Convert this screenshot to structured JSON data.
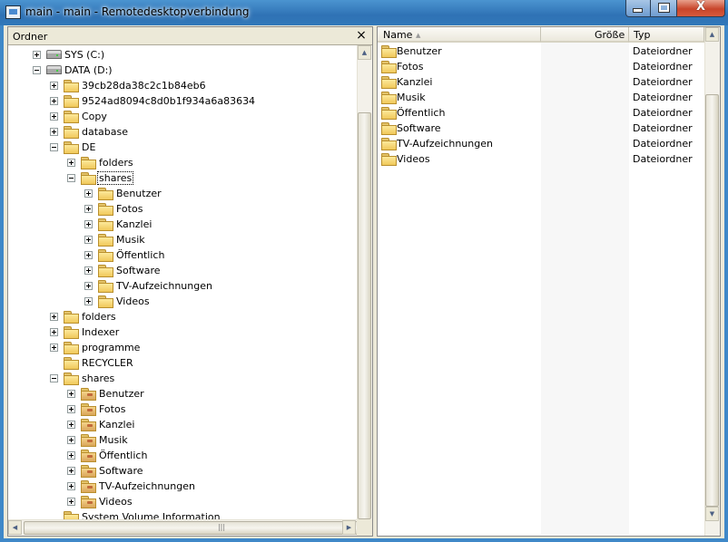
{
  "window": {
    "title": "main - main - Remotedesktopverbindung",
    "minimize_glyph": "",
    "maximize_glyph": "",
    "close_glyph": "X"
  },
  "folder_pane": {
    "title": "Ordner",
    "close_glyph": "×",
    "tree": [
      {
        "label": "SYS (C:)",
        "icon": "drive-icon",
        "expander": "plus",
        "depth": 0
      },
      {
        "label": "DATA (D:)",
        "icon": "drive-icon",
        "expander": "minus",
        "depth": 0
      },
      {
        "label": "39cb28da38c2c1b84eb6",
        "icon": "folder-icon",
        "expander": "plus",
        "depth": 1
      },
      {
        "label": "9524ad8094c8d0b1f934a6a83634",
        "icon": "folder-icon",
        "expander": "plus",
        "depth": 1
      },
      {
        "label": "Copy",
        "icon": "folder-icon",
        "expander": "plus",
        "depth": 1
      },
      {
        "label": "database",
        "icon": "folder-icon",
        "expander": "plus",
        "depth": 1
      },
      {
        "label": "DE",
        "icon": "folder-icon",
        "expander": "minus",
        "depth": 1
      },
      {
        "label": "folders",
        "icon": "folder-icon",
        "expander": "plus",
        "depth": 2
      },
      {
        "label": "shares",
        "icon": "folder-open-icon",
        "expander": "minus",
        "depth": 2,
        "selected": true
      },
      {
        "label": "Benutzer",
        "icon": "folder-icon",
        "expander": "plus",
        "depth": 3
      },
      {
        "label": "Fotos",
        "icon": "folder-icon",
        "expander": "plus",
        "depth": 3
      },
      {
        "label": "Kanzlei",
        "icon": "folder-icon",
        "expander": "plus",
        "depth": 3
      },
      {
        "label": "Musik",
        "icon": "folder-icon",
        "expander": "plus",
        "depth": 3
      },
      {
        "label": "Öffentlich",
        "icon": "folder-icon",
        "expander": "plus",
        "depth": 3
      },
      {
        "label": "Software",
        "icon": "folder-icon",
        "expander": "plus",
        "depth": 3
      },
      {
        "label": "TV-Aufzeichnungen",
        "icon": "folder-icon",
        "expander": "plus",
        "depth": 3
      },
      {
        "label": "Videos",
        "icon": "folder-icon",
        "expander": "plus",
        "depth": 3
      },
      {
        "label": "folders",
        "icon": "folder-icon",
        "expander": "plus",
        "depth": 1
      },
      {
        "label": "Indexer",
        "icon": "folder-icon",
        "expander": "plus",
        "depth": 1
      },
      {
        "label": "programme",
        "icon": "folder-icon",
        "expander": "plus",
        "depth": 1
      },
      {
        "label": "RECYCLER",
        "icon": "folder-icon",
        "expander": "none",
        "depth": 1
      },
      {
        "label": "shares",
        "icon": "folder-icon",
        "expander": "minus",
        "depth": 1
      },
      {
        "label": "Benutzer",
        "icon": "shared-folder-icon",
        "expander": "plus",
        "depth": 2
      },
      {
        "label": "Fotos",
        "icon": "shared-folder-icon",
        "expander": "plus",
        "depth": 2
      },
      {
        "label": "Kanzlei",
        "icon": "shared-folder-icon",
        "expander": "plus",
        "depth": 2
      },
      {
        "label": "Musik",
        "icon": "shared-folder-icon",
        "expander": "plus",
        "depth": 2
      },
      {
        "label": "Öffentlich",
        "icon": "shared-folder-icon",
        "expander": "plus",
        "depth": 2
      },
      {
        "label": "Software",
        "icon": "shared-folder-icon",
        "expander": "plus",
        "depth": 2
      },
      {
        "label": "TV-Aufzeichnungen",
        "icon": "shared-folder-icon",
        "expander": "plus",
        "depth": 2
      },
      {
        "label": "Videos",
        "icon": "shared-folder-icon",
        "expander": "plus",
        "depth": 2
      },
      {
        "label": "System Volume Information",
        "icon": "folder-icon",
        "expander": "none",
        "depth": 1
      }
    ],
    "hscroll_grip": "|||"
  },
  "file_list": {
    "columns": {
      "name": "Name",
      "size": "Größe",
      "type": "Typ"
    },
    "sort_indicator": "▲",
    "rows": [
      {
        "name": "Benutzer",
        "size": "",
        "type": "Dateiordner"
      },
      {
        "name": "Fotos",
        "size": "",
        "type": "Dateiordner"
      },
      {
        "name": "Kanzlei",
        "size": "",
        "type": "Dateiordner"
      },
      {
        "name": "Musik",
        "size": "",
        "type": "Dateiordner"
      },
      {
        "name": "Öffentlich",
        "size": "",
        "type": "Dateiordner"
      },
      {
        "name": "Software",
        "size": "",
        "type": "Dateiordner"
      },
      {
        "name": "TV-Aufzeichnungen",
        "size": "",
        "type": "Dateiordner"
      },
      {
        "name": "Videos",
        "size": "",
        "type": "Dateiordner"
      }
    ]
  },
  "scrollbar": {
    "up": "▲",
    "down": "▼",
    "left": "◀",
    "right": "▶"
  }
}
